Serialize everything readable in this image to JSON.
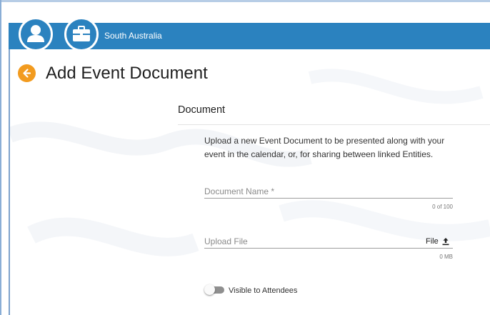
{
  "header": {
    "region": "South Australia",
    "user_icon": "user-icon",
    "briefcase_icon": "briefcase-icon",
    "bar_color": "#2b82bf"
  },
  "page": {
    "title": "Add Event Document",
    "back_icon": "arrow-left-icon",
    "accent_color": "#f29b1f"
  },
  "card": {
    "title": "Document",
    "description": "Upload a new Event Document to be presented along with your event in the calendar, or, for sharing between linked Entities."
  },
  "form": {
    "document_name": {
      "placeholder": "Document Name *",
      "value": "",
      "counter": "0 of 100"
    },
    "upload_file": {
      "placeholder": "Upload File",
      "button_label": "File",
      "button_icon": "upload-icon",
      "size": "0 MB"
    },
    "visible_toggle": {
      "label": "Visible to Attendees",
      "checked": false
    }
  }
}
